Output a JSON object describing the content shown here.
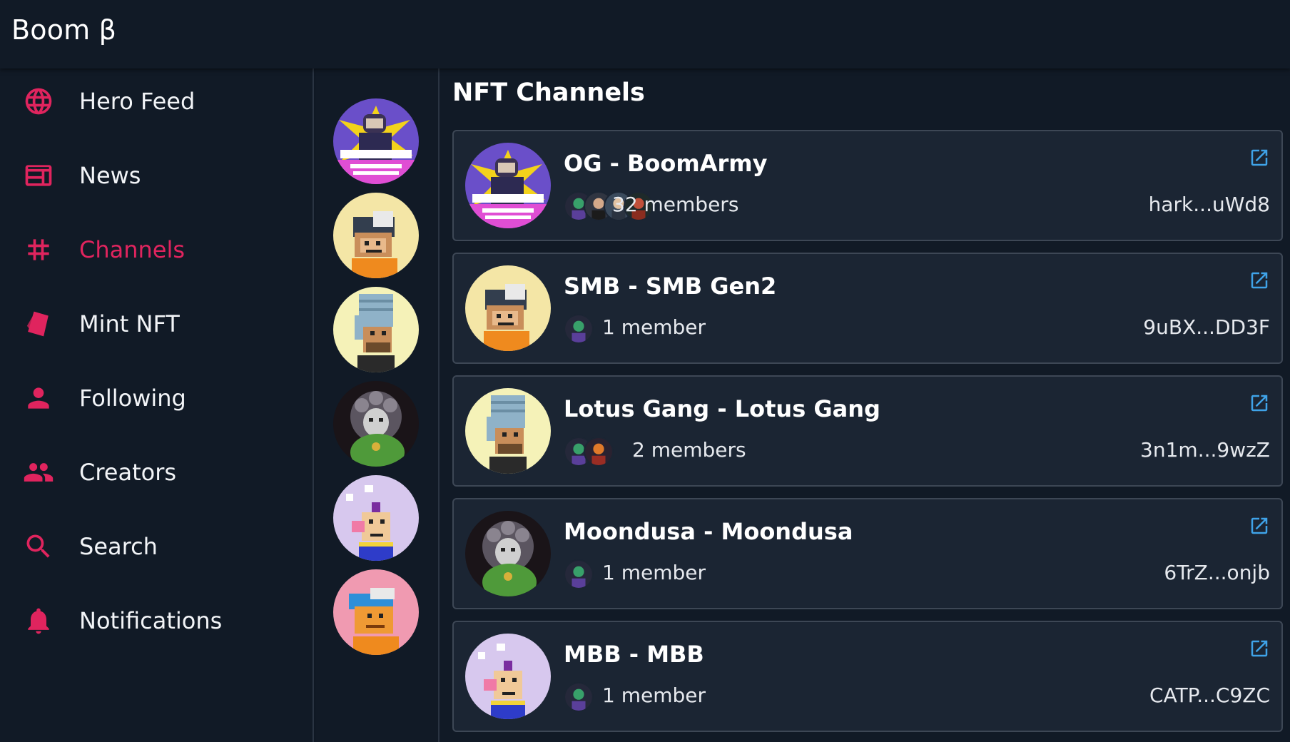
{
  "app": {
    "title": "Boom β"
  },
  "sidebar": {
    "items": [
      {
        "label": "Hero Feed",
        "icon": "globe-icon",
        "active": false
      },
      {
        "label": "News",
        "icon": "newspaper-icon",
        "active": false
      },
      {
        "label": "Channels",
        "icon": "hash-icon",
        "active": true
      },
      {
        "label": "Mint NFT",
        "icon": "tag-icon",
        "active": false
      },
      {
        "label": "Following",
        "icon": "person-icon",
        "active": false
      },
      {
        "label": "Creators",
        "icon": "group-icon",
        "active": false
      },
      {
        "label": "Search",
        "icon": "search-icon",
        "active": false
      },
      {
        "label": "Notifications",
        "icon": "bell-icon",
        "active": false
      }
    ]
  },
  "colors": {
    "accent": "#e0245e",
    "link": "#3fa3e8",
    "background": "#111a26",
    "card": "#1b2533"
  },
  "main": {
    "title": "NFT Channels",
    "channels": [
      {
        "name": "OG - BoomArmy",
        "members": "32 members",
        "address": "hark...uWd8",
        "avatar": "comic-soldier-nft"
      },
      {
        "name": "SMB - SMB Gen2",
        "members": "1 member",
        "address": "9uBX...DD3F",
        "avatar": "pixel-monkey-cap-nft"
      },
      {
        "name": "Lotus Gang - Lotus Gang",
        "members": "2 members",
        "address": "3n1m...9wzZ",
        "avatar": "pixel-monkey-beanie-nft"
      },
      {
        "name": "Moondusa - Moondusa",
        "members": "1 member",
        "address": "6TrZ...onjb",
        "avatar": "medusa-nft"
      },
      {
        "name": "MBB - MBB",
        "members": "1 member",
        "address": "CATP...C9ZC",
        "avatar": "pixel-punk-nft"
      }
    ]
  }
}
